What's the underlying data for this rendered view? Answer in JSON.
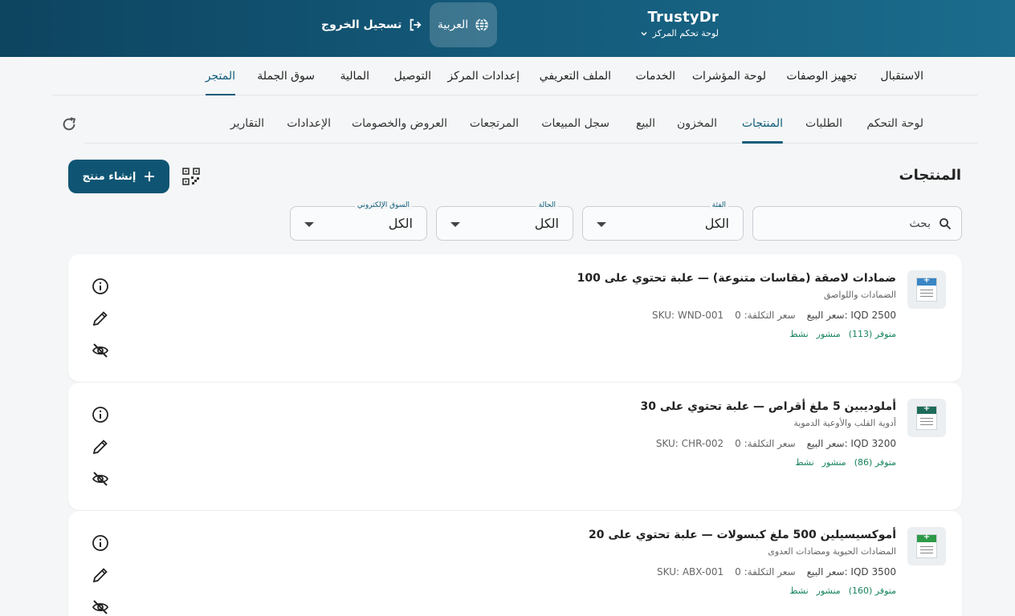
{
  "header": {
    "brand_title": "TrustyDr",
    "brand_subtitle": "لوحة تحكم المركز",
    "language": "العربية",
    "logout": "تسجيل الخروج"
  },
  "main_nav": [
    "الاستقبال",
    "تجهيز الوصفات",
    "لوحة المؤشرات",
    "الخدمات",
    "الملف التعريفي",
    "إعدادات المركز",
    "التوصيل",
    "المالية",
    "سوق الجملة",
    "المتجر"
  ],
  "main_nav_active": "المتجر",
  "sub_nav": [
    "لوحة التحكم",
    "الطلبات",
    "المنتجات",
    "المخزون",
    "البيع",
    "سجل المبيعات",
    "المرتجعات",
    "العروض والخصومات",
    "الإعدادات",
    "التقارير"
  ],
  "sub_nav_active": "المنتجات",
  "page": {
    "title": "المنتجات",
    "create_button": "إنشاء منتج"
  },
  "filters": {
    "search_placeholder": "بحث",
    "category": {
      "label": "الفئة",
      "value": "الكل"
    },
    "status": {
      "label": "الحالة",
      "value": "الكل"
    },
    "marketplace": {
      "label": "السوق الإلكتروني",
      "value": "الكل"
    }
  },
  "products": [
    {
      "name": "ضمادات لاصقة (مقاسات متنوعة) — علبة تحتوي على 100",
      "category": "الضمادات واللواصق",
      "price": "سعر البيع: IQD 2500",
      "cost": "سعر التكلفة: 0",
      "sku": "SKU: WND-001",
      "stock": "متوفر (113)",
      "published": "منشور",
      "active": "نشط",
      "thumb_color": "#3a86c5"
    },
    {
      "name": "أملوديبين 5 ملغ أقراص — علبة تحتوي على 30",
      "category": "أدوية القلب والأوعية الدموية",
      "price": "سعر البيع: IQD 3200",
      "cost": "سعر التكلفة: 0",
      "sku": "SKU: CHR-002",
      "stock": "متوفر (86)",
      "published": "منشور",
      "active": "نشط",
      "thumb_color": "#1f6b5a"
    },
    {
      "name": "أموكسيسيلين 500 ملغ كبسولات — علبة تحتوي على 20",
      "category": "المضادات الحيوية ومضادات العدوى",
      "price": "سعر البيع: IQD 3500",
      "cost": "سعر التكلفة: 0",
      "sku": "SKU: ABX-001",
      "stock": "متوفر (160)",
      "published": "منشور",
      "active": "نشط",
      "thumb_color": "#2e9a48"
    }
  ]
}
